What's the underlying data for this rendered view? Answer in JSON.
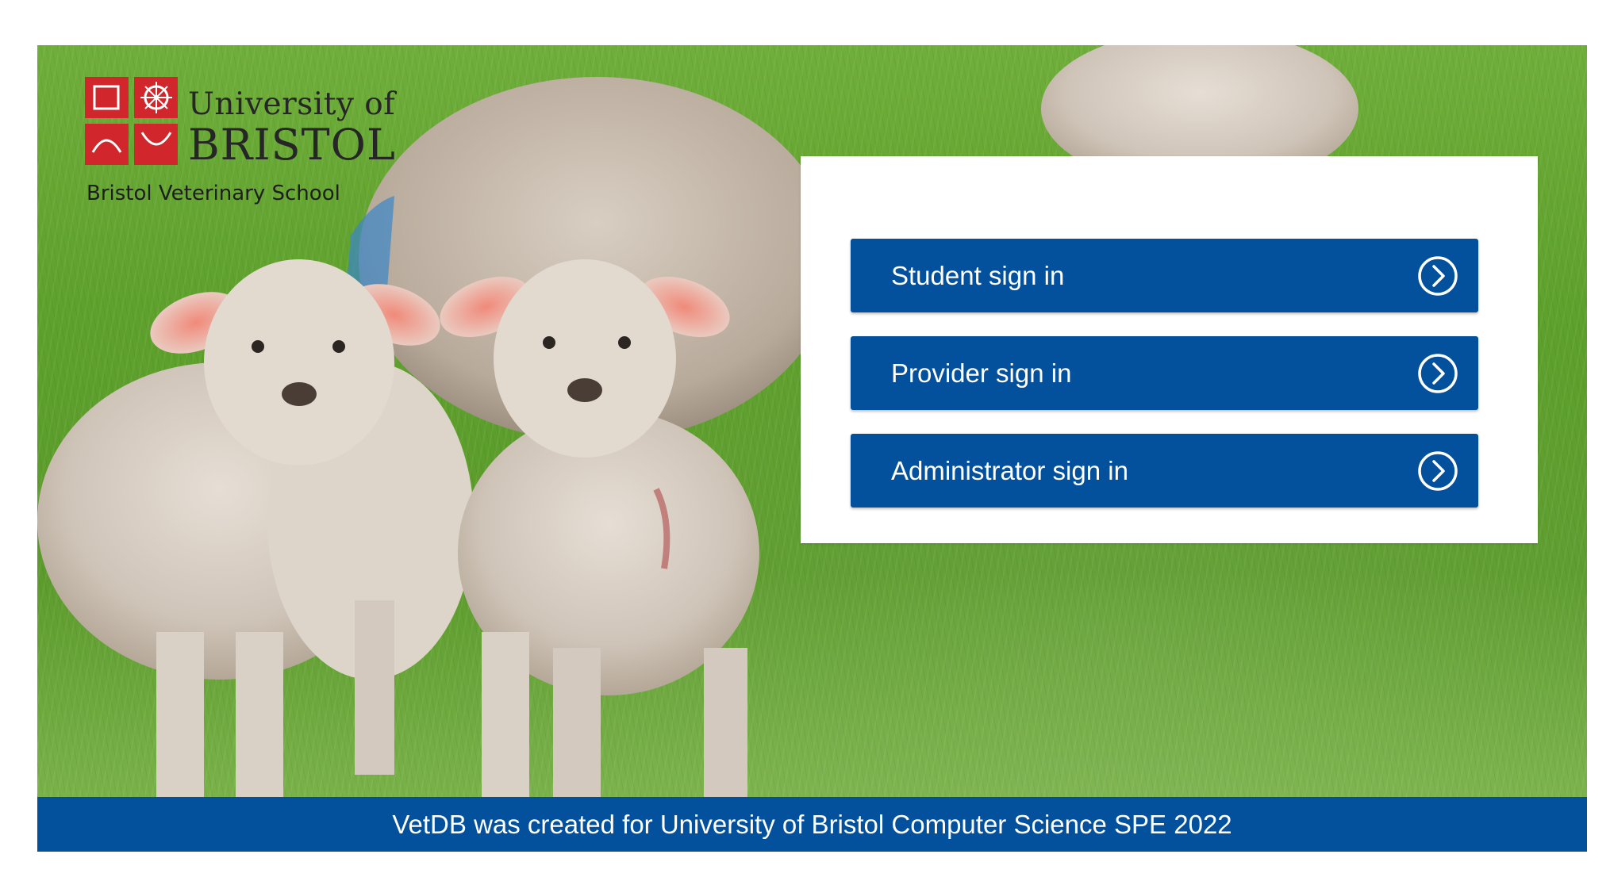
{
  "logo": {
    "line1": "University of",
    "line2": "BRISTOL",
    "subtitle": "Bristol Veterinary School",
    "crest_icon": "university-crest-icon",
    "crest_color": "#d0262c"
  },
  "hero": {
    "image": "lambs-in-field-photo"
  },
  "signin": {
    "buttons": [
      {
        "label": "Student sign in",
        "icon": "chevron-right-circle-icon"
      },
      {
        "label": "Provider sign in",
        "icon": "chevron-right-circle-icon"
      },
      {
        "label": "Administrator sign in",
        "icon": "chevron-right-circle-icon"
      }
    ]
  },
  "footer": {
    "text": "VetDB was created for University of Bristol Computer Science SPE 2022"
  },
  "colors": {
    "brand_blue": "#03509c",
    "panel_bg": "#ffffff",
    "grass_green": "#5ea12c"
  }
}
